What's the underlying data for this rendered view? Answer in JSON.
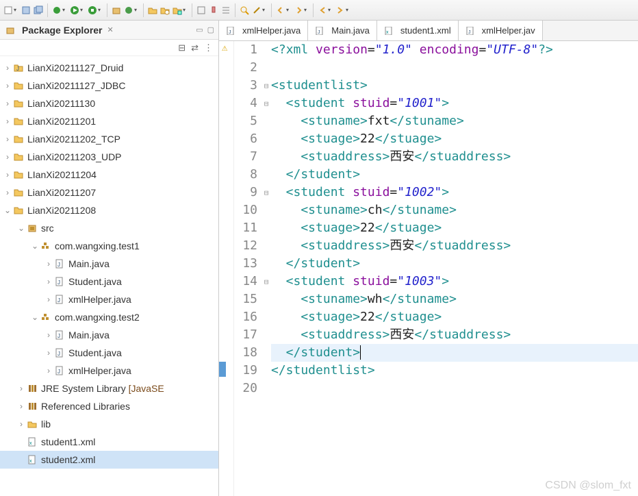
{
  "explorer": {
    "title": "Package Explorer",
    "projects": [
      {
        "label": "LianXi20211127_Druid"
      },
      {
        "label": "LianXi20211127_JDBC"
      },
      {
        "label": "LianXi20211130"
      },
      {
        "label": "LianXi20211201"
      },
      {
        "label": "LianXi20211202_TCP"
      },
      {
        "label": "LianXi20211203_UDP"
      },
      {
        "label": "LIanXi20211204"
      },
      {
        "label": "LianXi20211207"
      },
      {
        "label": "LianXi20211208"
      }
    ],
    "expanded": {
      "src": "src",
      "pkg1": "com.wangxing.test1",
      "pkg1_files": [
        "Main.java",
        "Student.java",
        "xmlHelper.java"
      ],
      "pkg2": "com.wangxing.test2",
      "pkg2_files": [
        "Main.java",
        "Student.java",
        "xmlHelper.java"
      ],
      "jre": "JRE System Library",
      "jre_suffix": "[JavaSE",
      "reflib": "Referenced Libraries",
      "lib": "lib",
      "xml1": "student1.xml",
      "xml2": "student2.xml"
    }
  },
  "tabs": [
    {
      "label": "xmlHelper.java",
      "type": "java"
    },
    {
      "label": "Main.java",
      "type": "java"
    },
    {
      "label": "student1.xml",
      "type": "xml"
    },
    {
      "label": "xmlHelper.jav",
      "type": "java"
    }
  ],
  "code": {
    "l1a": "<?",
    "l1b": "xml ",
    "l1c": "version",
    "l1d": "=",
    "l1e": "\"1.0\"",
    "l1f": " encoding",
    "l1g": "=",
    "l1h": "\"UTF-8\"",
    "l1i": "?>",
    "l3": "<studentlist>",
    "l4a": "  <student ",
    "l4b": "stuid",
    "l4c": "=",
    "l4d": "\"1001\"",
    "l4e": ">",
    "l5a": "    <stuname>",
    "l5b": "fxt",
    "l5c": "</stuname>",
    "l6a": "    <stuage>",
    "l6b": "22",
    "l6c": "</stuage>",
    "l7a": "    <stuaddress>",
    "l7b": "西安",
    "l7c": "</stuaddress>",
    "l8": "  </student>",
    "l9a": "  <student ",
    "l9b": "stuid",
    "l9c": "=",
    "l9d": "\"1002\"",
    "l9e": ">",
    "l10a": "    <stuname>",
    "l10b": "ch",
    "l10c": "</stuname>",
    "l11a": "    <stuage>",
    "l11b": "22",
    "l11c": "</stuage>",
    "l12a": "    <stuaddress>",
    "l12b": "西安",
    "l12c": "</stuaddress>",
    "l13": "  </student>",
    "l14a": "  <student ",
    "l14b": "stuid",
    "l14c": "=",
    "l14d": "\"1003\"",
    "l14e": ">",
    "l15a": "    <stuname>",
    "l15b": "wh",
    "l15c": "</stuname>",
    "l16a": "    <stuage>",
    "l16b": "22",
    "l16c": "</stuage>",
    "l17a": "    <stuaddress>",
    "l17b": "西安",
    "l17c": "</stuaddress>",
    "l18": "  </student>",
    "l19": "</studentlist>"
  },
  "lines": [
    "1",
    "2",
    "3",
    "4",
    "5",
    "6",
    "7",
    "8",
    "9",
    "10",
    "11",
    "12",
    "13",
    "14",
    "15",
    "16",
    "17",
    "18",
    "19",
    "20"
  ],
  "watermark": "CSDN @slom_fxt"
}
